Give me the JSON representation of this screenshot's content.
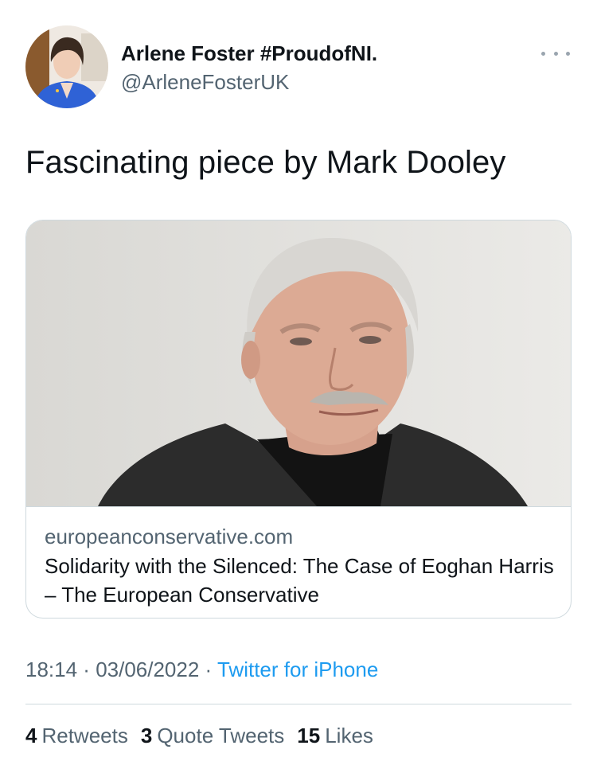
{
  "author": {
    "display_name": "Arlene Foster #ProudofNI.",
    "handle": "@ArleneFosterUK"
  },
  "more_icon": "more-horizontal-icon",
  "tweet_text": "Fascinating piece by Mark Dooley",
  "card": {
    "domain": "europeanconservative.com",
    "title": "Solidarity with the Silenced: The Case of Eoghan Harris – The European Conservative"
  },
  "meta": {
    "time": "18:14",
    "separator_1": " · ",
    "date": "03/06/2022",
    "separator_2": " · ",
    "source": "Twitter for iPhone"
  },
  "stats": {
    "retweets_count": "4",
    "retweets_label": "Retweets",
    "quotes_count": "3",
    "quotes_label": "Quote Tweets",
    "likes_count": "15",
    "likes_label": "Likes"
  },
  "colors": {
    "link": "#1d9bf0",
    "secondary_text": "#536471",
    "primary_text": "#0f1419",
    "border": "#cfd9de"
  }
}
